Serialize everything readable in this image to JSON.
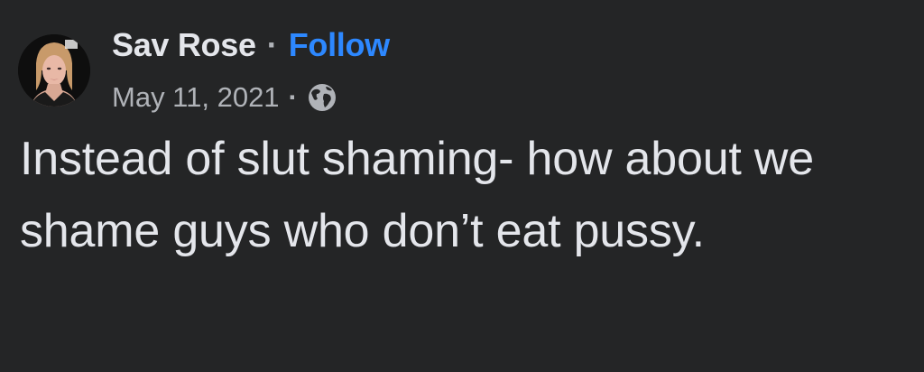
{
  "author": {
    "name": "Sav Rose",
    "separator": "·",
    "follow_label": "Follow"
  },
  "meta": {
    "date": "May 11, 2021",
    "separator": "·",
    "privacy_icon": "globe-icon"
  },
  "post": {
    "text": "Instead of slut shaming- how about we shame guys who don’t eat pussy."
  },
  "colors": {
    "background": "#242526",
    "text": "#e4e6eb",
    "secondary_text": "#b0b3b8",
    "link": "#2d88ff"
  }
}
